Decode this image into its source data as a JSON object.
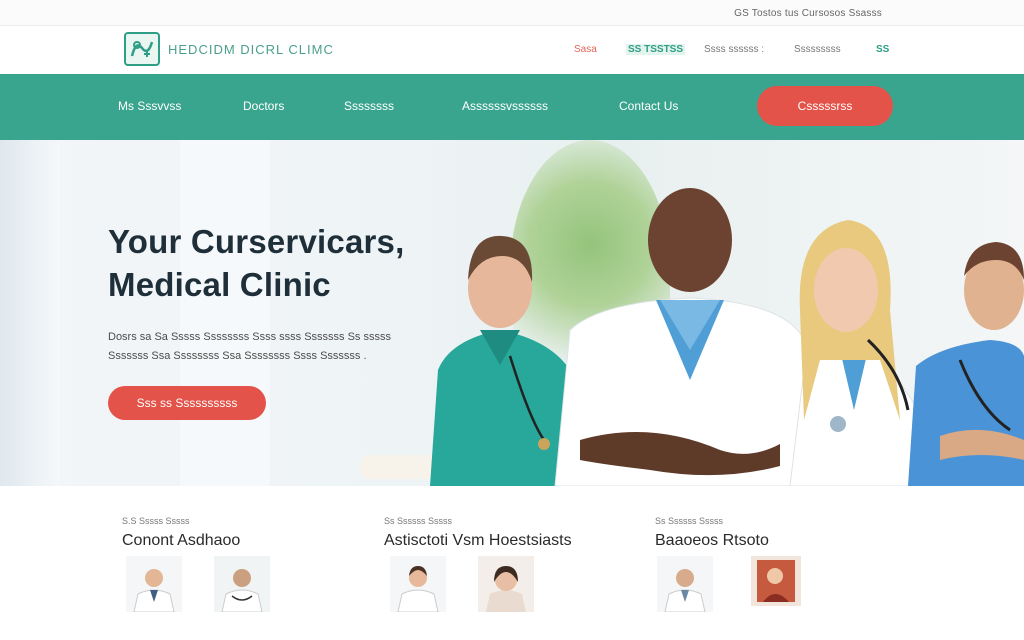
{
  "topbar": {
    "utility_text": "GS Tostos tus  Cursosos  Ssasss"
  },
  "header": {
    "brand": "HEDCIDM DICRL CLIMC",
    "links": [
      "Sasa",
      "SS TSSTSS",
      "Ssss ssssss :",
      "Sssssssss",
      "SS"
    ]
  },
  "nav": {
    "items": [
      "Ms Sssvvss",
      "Doctors",
      "Ssssssss",
      "Assssssvssssss",
      "Contact Us"
    ],
    "cta_label": "Csssssrss"
  },
  "hero": {
    "title_line1": "Your Curservicars,",
    "title_line2": "Medical Clinic",
    "subtitle_line1": "Dosrs sa  Sa Sssss  Ssssssss  Ssss  ssss  Sssssss  Ss  sssss",
    "subtitle_line2": "Sssssss  Ssa  Ssssssss  Ssa  Ssssssss  Ssss  Sssssss .",
    "cta_label": "Sss ss Ssssssssss"
  },
  "services": [
    {
      "kicker": "S.S Sssss Sssss",
      "title": "Conont Asdhaoo"
    },
    {
      "kicker": "Ss Ssssss Sssss",
      "title": "Astisctoti Vsm Hoestsiasts"
    },
    {
      "kicker": "Ss Ssssss Sssss",
      "title": "Baaoeos Rtsoto"
    }
  ],
  "colors": {
    "teal": "#3aa58e",
    "coral": "#e35349",
    "dark_text": "#1f2f3a"
  },
  "icons": [
    "clinic-logo-icon"
  ]
}
